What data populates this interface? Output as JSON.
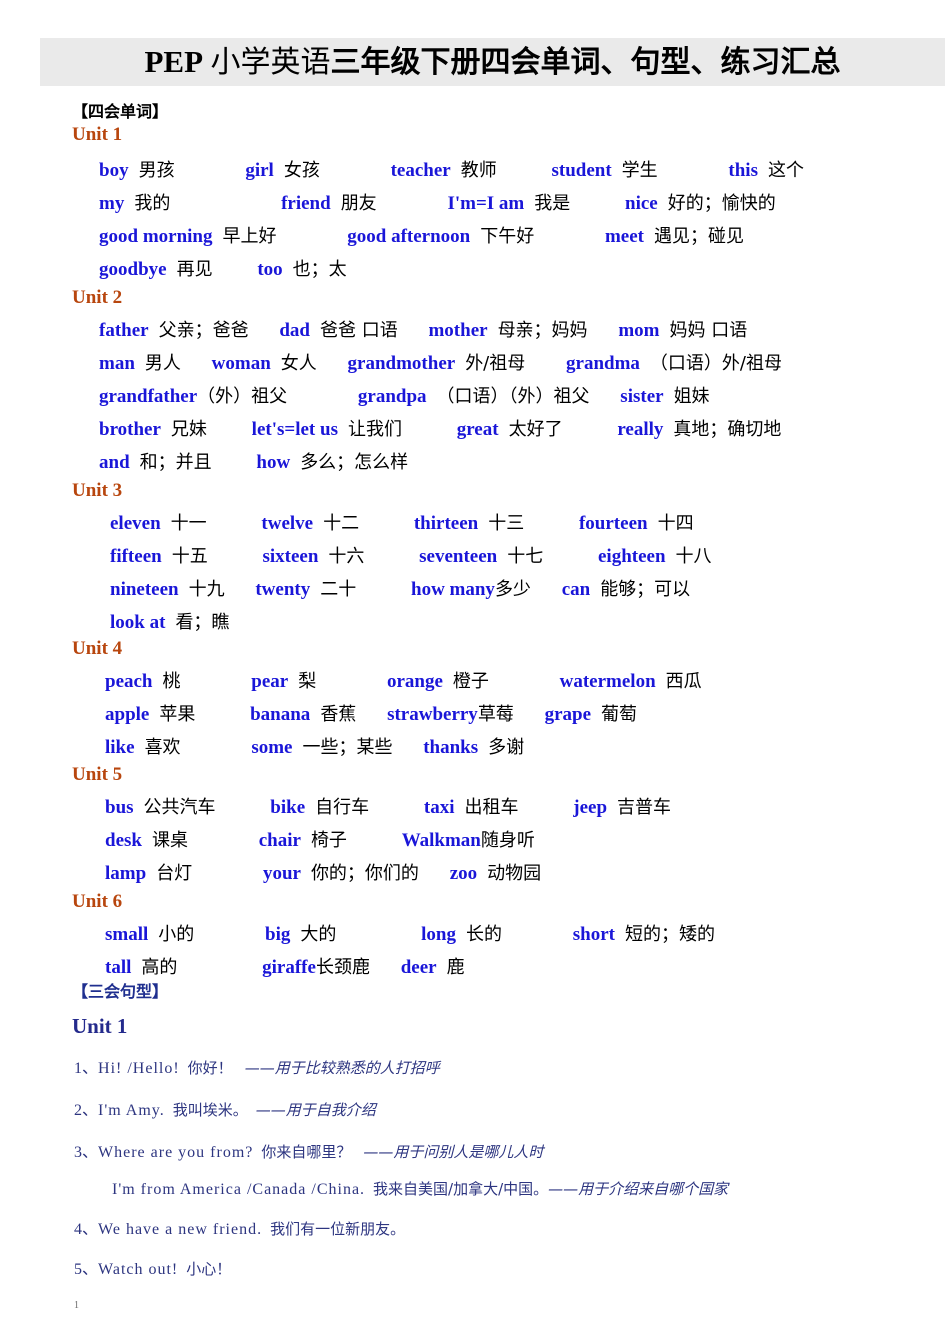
{
  "document": {
    "title_parts": {
      "pep": "PEP",
      "light_cn": " 小学英语",
      "heavy_cn": "三年级下册四会单词、句型、练习汇总"
    },
    "title_full": "PEP 小学英语三年级下册四会单词、句型、练习汇总",
    "page_number": "1"
  },
  "sections": {
    "vocabulary_heading": "【四会单词】",
    "sentences_heading": "【三会句型】"
  },
  "vocab_units": [
    {
      "unit_label": "Unit  1",
      "lines": [
        [
          {
            "en": "boy",
            "cn": "男孩"
          },
          {
            "en": "girl",
            "cn": "女孩"
          },
          {
            "en": "teacher",
            "cn": "教师"
          },
          {
            "en": "student",
            "cn": "学生"
          },
          {
            "en": "this",
            "cn": "这个"
          }
        ],
        [
          {
            "en": "my",
            "cn": "我的"
          },
          {
            "en": "friend",
            "cn": "朋友"
          },
          {
            "en": "I'm=I am",
            "cn": "我是"
          },
          {
            "en": "nice",
            "cn": "好的；愉快的"
          }
        ],
        [
          {
            "en": "good morning",
            "cn": "早上好"
          },
          {
            "en": "good afternoon",
            "cn": "下午好"
          },
          {
            "en": "meet",
            "cn": "遇见；碰见"
          }
        ],
        [
          {
            "en": "goodbye",
            "cn": "再见"
          },
          {
            "en": "too",
            "cn": "也；太"
          }
        ]
      ]
    },
    {
      "unit_label": "Unit  2",
      "lines": [
        [
          {
            "en": "father",
            "cn": "父亲；爸爸"
          },
          {
            "en": "dad",
            "cn": "爸爸 口语"
          },
          {
            "en": "mother",
            "cn": "母亲；妈妈"
          },
          {
            "en": "mom",
            "cn": "妈妈 口语"
          }
        ],
        [
          {
            "en": "man",
            "cn": "男人"
          },
          {
            "en": "woman",
            "cn": "女人"
          },
          {
            "en": "grandmother",
            "cn": "外/祖母"
          },
          {
            "en": "grandma",
            "cn": "（口语）外/祖母"
          }
        ],
        [
          {
            "en": "grandfather",
            "cn": "（外）祖父"
          },
          {
            "en": "grandpa",
            "cn": "（口语）（外）祖父"
          },
          {
            "en": "sister",
            "cn": "姐妹"
          }
        ],
        [
          {
            "en": "brother",
            "cn": "兄妹"
          },
          {
            "en": "let's=let us",
            "cn": "让我们"
          },
          {
            "en": "great",
            "cn": "太好了"
          },
          {
            "en": "really",
            "cn": "真地；确切地"
          }
        ],
        [
          {
            "en": "and",
            "cn": "和；并且"
          },
          {
            "en": "how",
            "cn": "多么；怎么样"
          }
        ]
      ]
    },
    {
      "unit_label": "Unit  3",
      "lines": [
        [
          {
            "en": "eleven",
            "cn": "十一"
          },
          {
            "en": "twelve",
            "cn": "十二"
          },
          {
            "en": "thirteen",
            "cn": "十三"
          },
          {
            "en": "fourteen",
            "cn": "十四"
          }
        ],
        [
          {
            "en": "fifteen",
            "cn": "十五"
          },
          {
            "en": "sixteen",
            "cn": "十六"
          },
          {
            "en": "seventeen",
            "cn": "十七"
          },
          {
            "en": "eighteen",
            "cn": "十八"
          }
        ],
        [
          {
            "en": "nineteen",
            "cn": "十九"
          },
          {
            "en": "twenty",
            "cn": "二十"
          },
          {
            "en": "how many",
            "cn": "多少"
          },
          {
            "en": "can",
            "cn": "能够；可以"
          }
        ],
        [
          {
            "en": "look at",
            "cn": "看；瞧"
          }
        ]
      ]
    },
    {
      "unit_label": "Unit  4",
      "lines": [
        [
          {
            "en": "peach",
            "cn": "桃"
          },
          {
            "en": "pear",
            "cn": "梨"
          },
          {
            "en": "orange",
            "cn": "橙子"
          },
          {
            "en": "watermelon",
            "cn": "西瓜"
          }
        ],
        [
          {
            "en": "apple",
            "cn": "苹果"
          },
          {
            "en": "banana",
            "cn": "香蕉"
          },
          {
            "en": "strawberry",
            "cn": "草莓"
          },
          {
            "en": "grape",
            "cn": "葡萄"
          }
        ],
        [
          {
            "en": "like",
            "cn": "喜欢"
          },
          {
            "en": "some",
            "cn": "一些；某些"
          },
          {
            "en": "thanks",
            "cn": "多谢"
          }
        ]
      ]
    },
    {
      "unit_label": "Unit  5",
      "lines": [
        [
          {
            "en": "bus",
            "cn": "公共汽车"
          },
          {
            "en": "bike",
            "cn": "自行车"
          },
          {
            "en": "taxi",
            "cn": "出租车"
          },
          {
            "en": "jeep",
            "cn": "吉普车"
          }
        ],
        [
          {
            "en": "desk",
            "cn": "课桌"
          },
          {
            "en": "chair",
            "cn": "椅子"
          },
          {
            "en": "Walkman",
            "cn": "随身听"
          }
        ],
        [
          {
            "en": "lamp",
            "cn": "台灯"
          },
          {
            "en": "your",
            "cn": "你的；你们的"
          },
          {
            "en": "zoo",
            "cn": "动物园"
          }
        ]
      ]
    },
    {
      "unit_label": "Unit  6",
      "lines": [
        [
          {
            "en": "small",
            "cn": "小的"
          },
          {
            "en": "big",
            "cn": "大的"
          },
          {
            "en": "long",
            "cn": "长的"
          },
          {
            "en": "short",
            "cn": "短的；矮的"
          }
        ],
        [
          {
            "en": "tall",
            "cn": "高的"
          },
          {
            "en": "giraffe",
            "cn": "长颈鹿"
          },
          {
            "en": "deer",
            "cn": "鹿"
          }
        ]
      ]
    }
  ],
  "sentence_section": {
    "unit_label": "Unit 1",
    "items": [
      {
        "num": "1、",
        "en": "Hi! /Hello!",
        "cn": "你好！",
        "note": "——用于比较熟悉的人打招呼"
      },
      {
        "num": "2、",
        "en": "I'm Amy.",
        "cn": "我叫埃米。",
        "note": "——用于自我介绍"
      },
      {
        "num": "3、",
        "en": "Where are you from?",
        "cn": "你来自哪里？",
        "note": "——用于问别人是哪儿人时"
      },
      {
        "num": "",
        "en": "I'm from America /Canada /China.",
        "cn": "我来自美国/加拿大/中国。",
        "note": "——用于介绍来自哪个国家"
      },
      {
        "num": "4、",
        "en": "We have a new friend.",
        "cn": "我们有一位新朋友。",
        "note": ""
      },
      {
        "num": "5、",
        "en": "Watch out!",
        "cn": "小心！",
        "note": ""
      }
    ]
  }
}
